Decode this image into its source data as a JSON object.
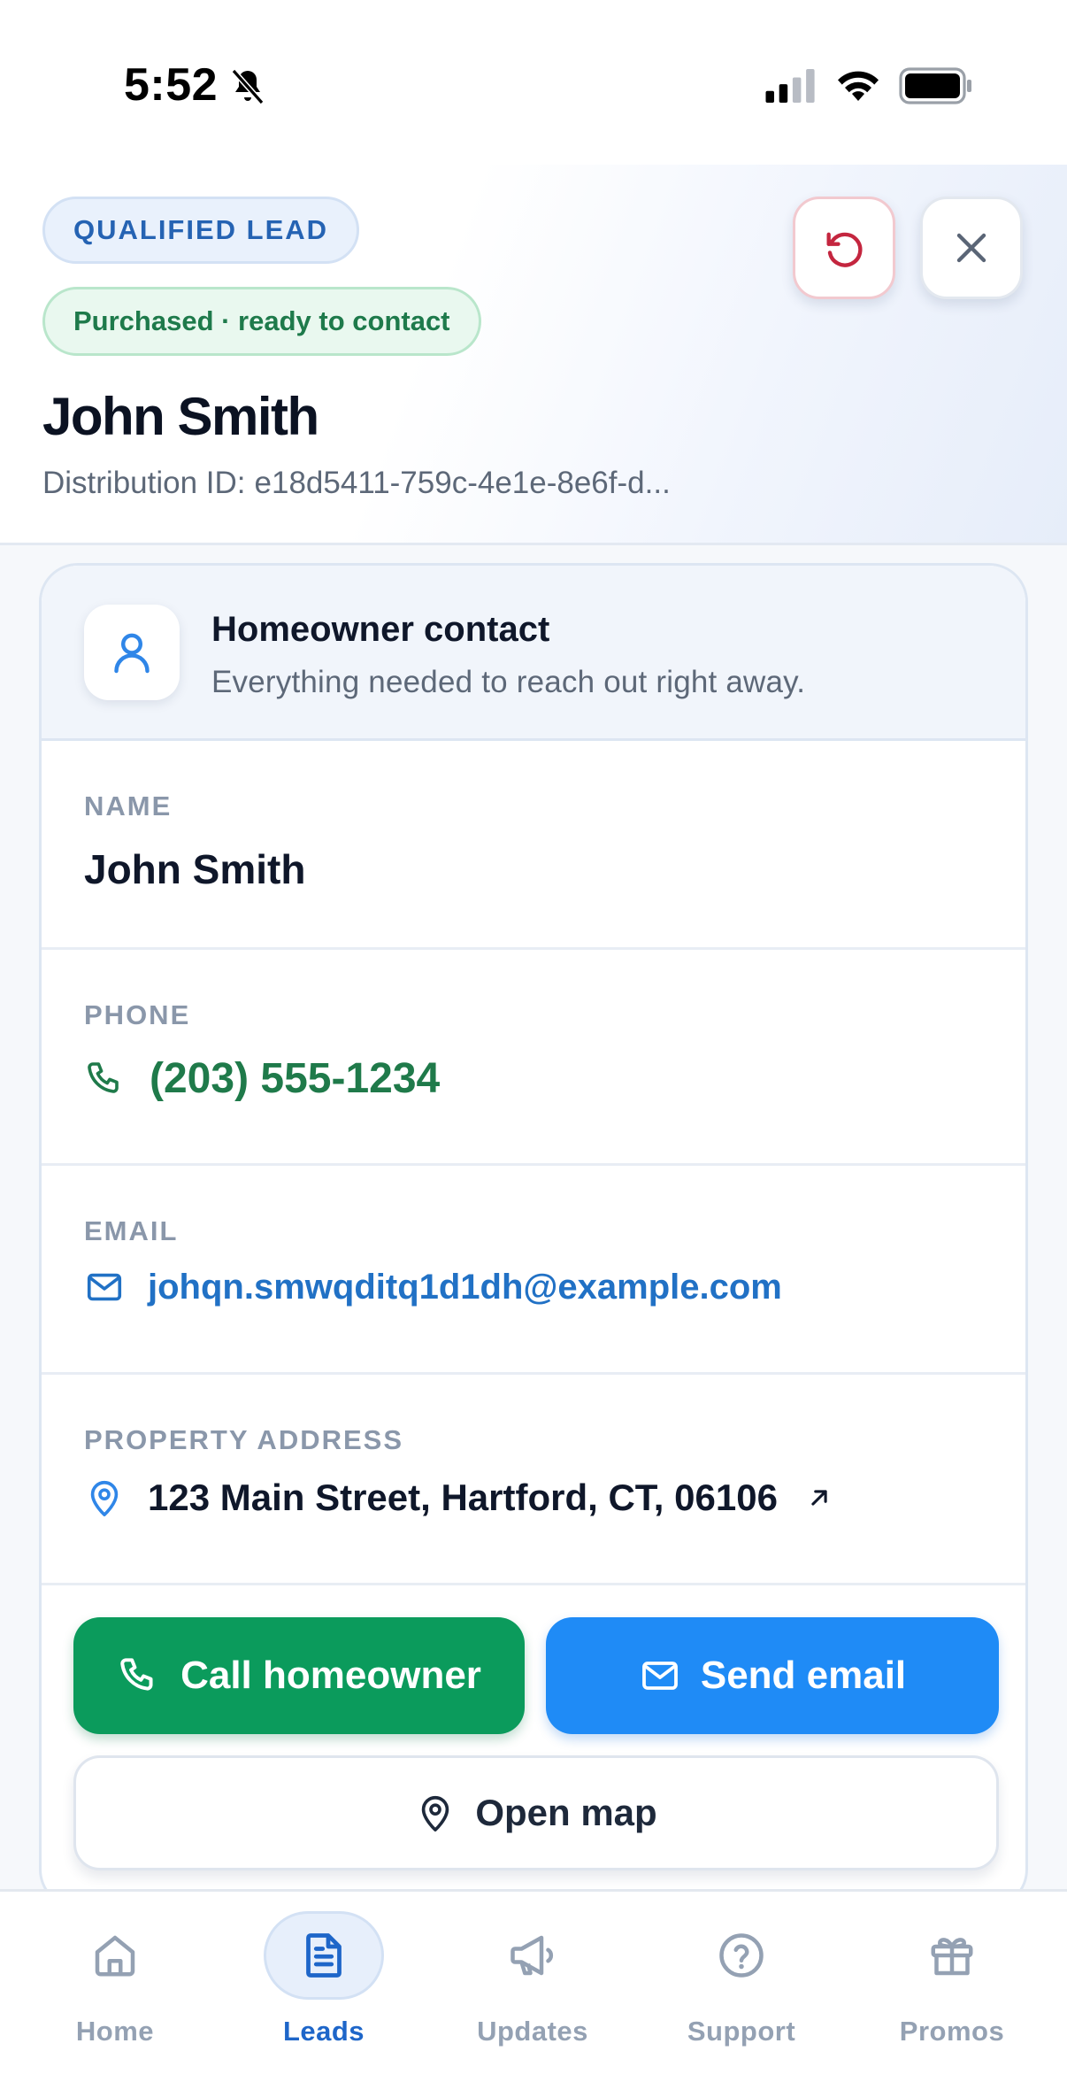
{
  "status_bar": {
    "time": "5:52",
    "icons": [
      "bell-slash-icon",
      "cellular-signal-icon",
      "wifi-icon",
      "battery-icon"
    ]
  },
  "header": {
    "qualified_badge": "QUALIFIED LEAD",
    "status_badge": "Purchased · ready to contact",
    "lead_name": "John Smith",
    "distribution_label": "Distribution ID:",
    "distribution_id": "e18d5411-759c-4e1e-8e6f-d...",
    "undo_icon": "undo-icon",
    "close_icon": "close-icon"
  },
  "contact_card": {
    "title": "Homeowner contact",
    "subtitle": "Everything needed to reach out right away.",
    "fields": {
      "name": {
        "label": "NAME",
        "value": "John Smith"
      },
      "phone": {
        "label": "PHONE",
        "value": "(203) 555-1234"
      },
      "email": {
        "label": "EMAIL",
        "value": "johqn.smwqditq1d1dh@example.com"
      },
      "address": {
        "label": "PROPERTY ADDRESS",
        "value": "123 Main Street, Hartford, CT, 06106"
      }
    },
    "actions": {
      "call": "Call homeowner",
      "email": "Send email",
      "map": "Open map"
    }
  },
  "tabbar": {
    "tabs": [
      {
        "label": "Home",
        "icon": "home-icon",
        "active": false
      },
      {
        "label": "Leads",
        "icon": "document-icon",
        "active": true
      },
      {
        "label": "Updates",
        "icon": "megaphone-icon",
        "active": false
      },
      {
        "label": "Support",
        "icon": "help-circle-icon",
        "active": false
      },
      {
        "label": "Promos",
        "icon": "gift-icon",
        "active": false
      }
    ]
  },
  "colors": {
    "call_green": "#0b9b5c",
    "email_blue": "#1f8bf6",
    "phone_text_green": "#1f7a4a",
    "link_blue": "#2171c5",
    "active_tab_blue": "#1e66c9"
  }
}
